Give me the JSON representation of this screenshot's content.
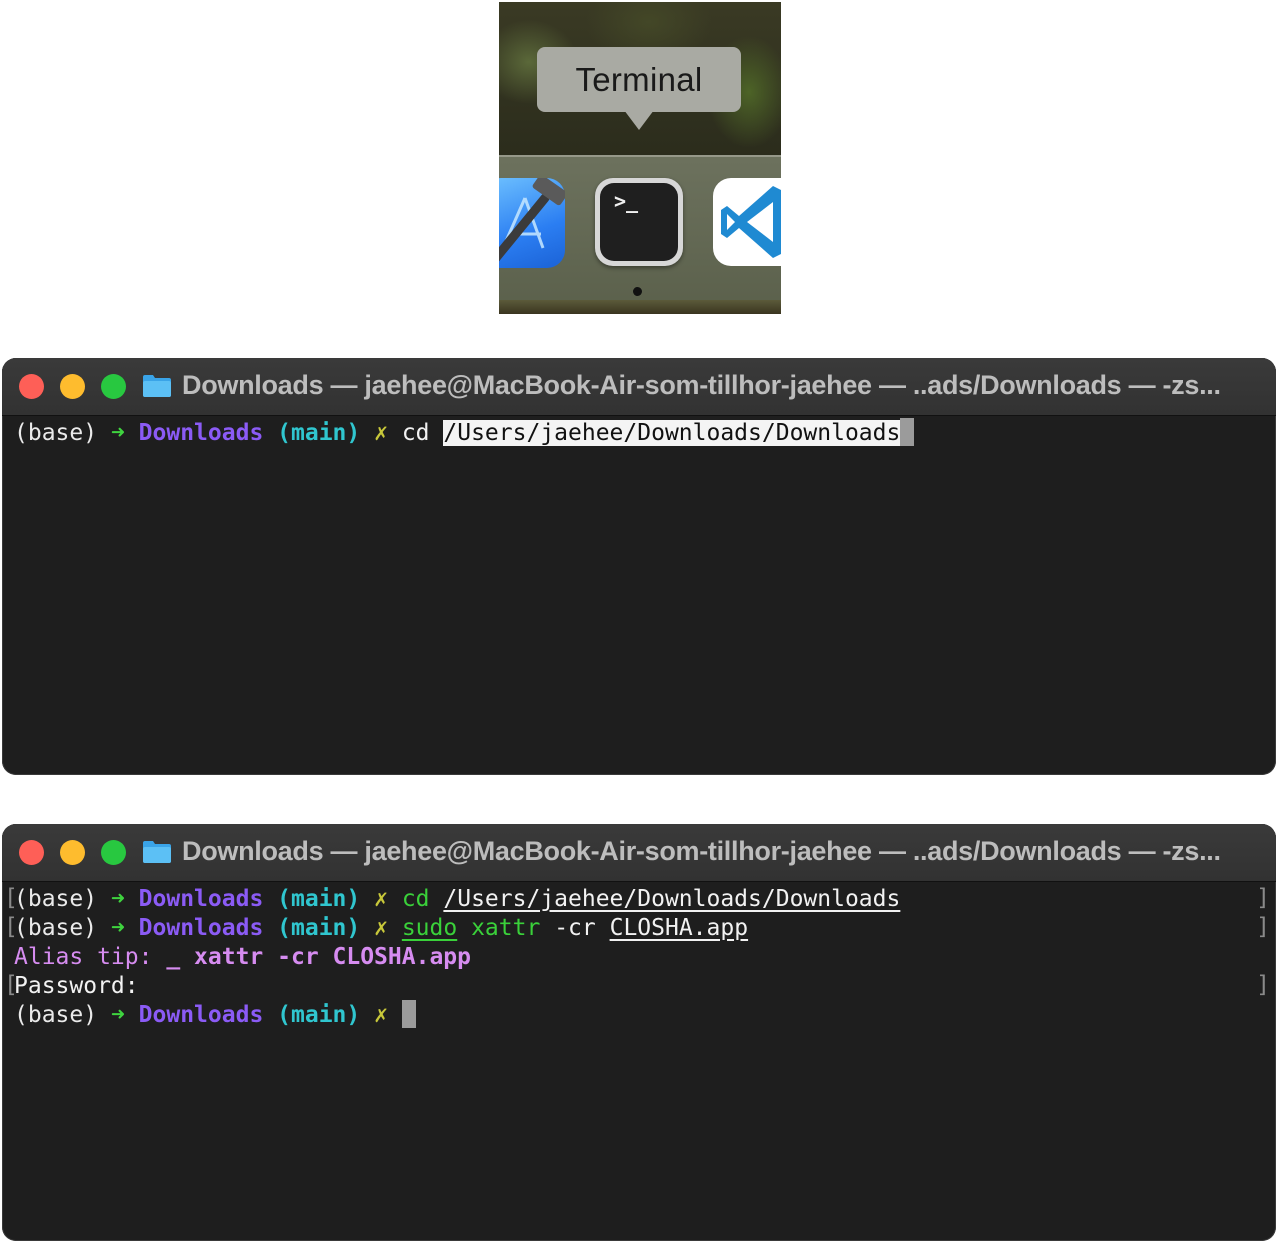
{
  "dock": {
    "tooltip": "Terminal",
    "apps": [
      {
        "name": "Xcode",
        "icon": "xcode-icon"
      },
      {
        "name": "Terminal",
        "icon": "terminal-icon",
        "glyph": ">_"
      },
      {
        "name": "Visual Studio Code",
        "icon": "vscode-icon"
      }
    ]
  },
  "windows": [
    {
      "title": "Downloads — jaehee@MacBook-Air-som-tillhor-jaehee — ..ads/Downloads — -zs...",
      "lines": [
        {
          "base": "(base)",
          "arrow": "➜",
          "dir": "Downloads",
          "branch": "(main)",
          "x": "✗",
          "cmd": "cd",
          "arg": "/Users/jaehee/Downloads/Downloads"
        }
      ]
    },
    {
      "title": "Downloads — jaehee@MacBook-Air-som-tillhor-jaehee — ..ads/Downloads — -zs...",
      "lines": [
        {
          "base": "(base)",
          "arrow": "➜",
          "dir": "Downloads",
          "branch": "(main)",
          "x": "✗",
          "cmd": "cd",
          "arg": "/Users/jaehee/Downloads/Downloads"
        },
        {
          "base": "(base)",
          "arrow": "➜",
          "dir": "Downloads",
          "branch": "(main)",
          "x": "✗",
          "cmd1": "sudo",
          "cmd2": "xattr",
          "flag": "-cr",
          "arg": "CLOSHA.app"
        },
        {
          "alias_label": "Alias tip:",
          "alias_cmd": "_ xattr -cr CLOSHA.app"
        },
        {
          "password": "Password:"
        },
        {
          "base": "(base)",
          "arrow": "➜",
          "dir": "Downloads",
          "branch": "(main)",
          "x": "✗"
        }
      ]
    }
  ],
  "colors": {
    "close": "#fe5f57",
    "minimize": "#febc2e",
    "zoom": "#28c840",
    "directory": "#8b5bf5",
    "branch": "#30c6cf",
    "arrow": "#3fd43f",
    "dirty_mark": "#c8c83a",
    "alias": "#d68cf0"
  }
}
